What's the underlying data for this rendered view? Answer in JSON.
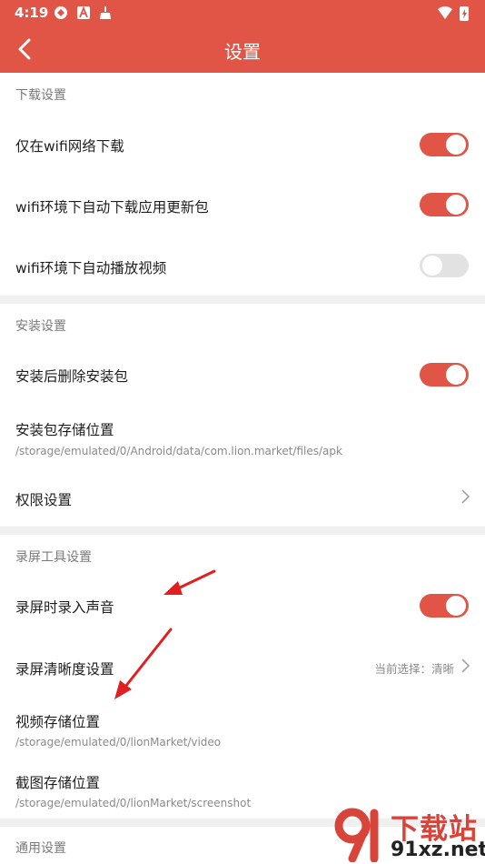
{
  "status_bar": {
    "time": "4:19"
  },
  "header": {
    "title": "设置"
  },
  "sections": {
    "download": {
      "title": "下载设置",
      "items": [
        {
          "label": "仅在wifi网络下载",
          "toggle": "on"
        },
        {
          "label": "wifi环境下自动下载应用更新包",
          "toggle": "on"
        },
        {
          "label": "wifi环境下自动播放视频",
          "toggle": "off"
        }
      ]
    },
    "install": {
      "title": "安装设置",
      "items": [
        {
          "label": "安装后删除安装包",
          "toggle": "on"
        },
        {
          "label": "安装包存储位置",
          "path": "/storage/emulated/0/Android/data/com.lion.market/files/apk"
        },
        {
          "label": "权限设置"
        }
      ]
    },
    "record": {
      "title": "录屏工具设置",
      "items": [
        {
          "label": "录屏时录入声音",
          "toggle": "on"
        },
        {
          "label": "录屏清晰度设置",
          "value": "当前选择：清晰"
        },
        {
          "label": "视频存储位置",
          "path": "/storage/emulated/0/lionMarket/video"
        },
        {
          "label": "截图存储位置",
          "path": "/storage/emulated/0/lionMarket/screenshot"
        }
      ]
    },
    "general": {
      "title": "通用设置"
    }
  },
  "watermark": {
    "title": "下载站",
    "domain": "91xz.net"
  },
  "colors": {
    "accent": "#e05545",
    "toggle_off": "#e2e2e2",
    "divider": "#f0f0f0",
    "arrow": "#e02020"
  }
}
